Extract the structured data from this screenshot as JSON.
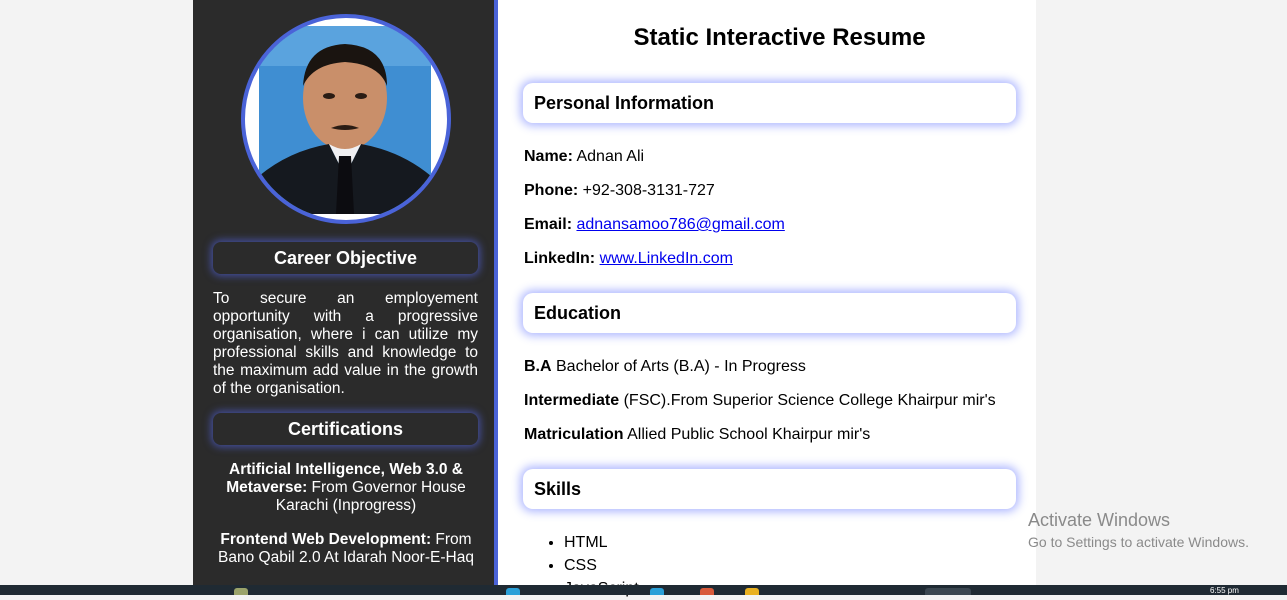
{
  "sidebar": {
    "career_heading": "Career Objective",
    "career_text": "To secure an employement opportunity with a progressive organisation, where i can utilize my professional skills and knowledge to the maximum add value in the growth of the organisation.",
    "cert_heading": "Certifications",
    "certs": [
      {
        "bold": "Artificial Intelligence, Web 3.0 & Metaverse:",
        "text": " From Governor House Karachi (Inprogress)"
      },
      {
        "bold": "Frontend Web Development:",
        "text": " From Bano Qabil 2.0 At Idarah Noor-E-Haq"
      }
    ]
  },
  "main": {
    "title": "Static Interactive Resume",
    "personal_heading": "Personal Information",
    "name_label": "Name:",
    "name_value": "Adnan Ali",
    "phone_label": "Phone:",
    "phone_value": "+92-308-3131-727",
    "email_label": "Email:",
    "email_value": "adnansamoo786@gmail.com",
    "linkedin_label": "LinkedIn:",
    "linkedin_value": "www.LinkedIn.com",
    "education_heading": "Education",
    "education": [
      {
        "bold": "B.A",
        "text": " Bachelor of Arts (B.A) - In Progress"
      },
      {
        "bold": "Intermediate",
        "text": " (FSC).From Superior Science College Khairpur mir's"
      },
      {
        "bold": "Matriculation",
        "text": " Allied Public School Khairpur mir's"
      }
    ],
    "skills_heading": "Skills",
    "skills": [
      "HTML",
      "CSS",
      "JavaScript"
    ]
  },
  "watermark": {
    "title": "Activate Windows",
    "subtitle": "Go to Settings to activate Windows."
  },
  "taskbar": {
    "time": "6:55 pm"
  },
  "colors": {
    "accent": "#4a63d8",
    "sidebar_bg": "#2b2b2b",
    "link": "#0000ee"
  }
}
